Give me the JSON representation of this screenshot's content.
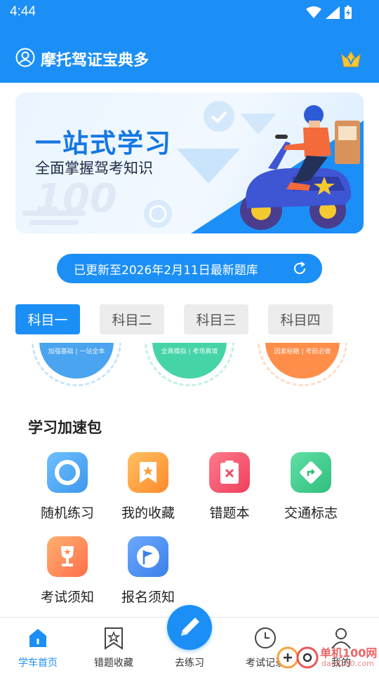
{
  "status": {
    "time": "4:44"
  },
  "header": {
    "title": "摩托驾证宝典多"
  },
  "banner": {
    "title": "一站式学习",
    "subtitle": "全面掌握驾考知识",
    "badge_text": "100"
  },
  "update": {
    "text": "已更新至2026年2月11日最新题库"
  },
  "tabs": [
    {
      "label": "科目一",
      "active": true
    },
    {
      "label": "科目二",
      "active": false
    },
    {
      "label": "科目三",
      "active": false
    },
    {
      "label": "科目四",
      "active": false
    }
  ],
  "circles": [
    {
      "caption": "加强基础 | 一站全本",
      "color": "#4aa4ef"
    },
    {
      "caption": "全真模拟 | 考场真境",
      "color": "#45d3a8"
    },
    {
      "caption": "因素秘籍 | 考前必做",
      "color": "#ff8e4a"
    }
  ],
  "section": {
    "title": "学习加速包"
  },
  "tiles": [
    {
      "label": "随机练习",
      "icon": "target-icon",
      "color": "#49a8f1"
    },
    {
      "label": "我的收藏",
      "icon": "bookmark-star-icon",
      "color": "#ff9f3a"
    },
    {
      "label": "错题本",
      "icon": "clipboard-x-icon",
      "color": "#f6556e"
    },
    {
      "label": "交通标志",
      "icon": "turn-sign-icon",
      "color": "#3cc98a"
    },
    {
      "label": "考试须知",
      "icon": "trophy-icon",
      "color": "#ff8a57"
    },
    {
      "label": "报名须知",
      "icon": "flag-icon",
      "color": "#4a8cf0"
    }
  ],
  "nav": [
    {
      "label": "学车首页",
      "icon": "home-icon",
      "active": true
    },
    {
      "label": "错题收藏",
      "icon": "bookmark-icon",
      "active": false
    },
    {
      "label": "去练习",
      "icon": "pencil-icon",
      "active": false
    },
    {
      "label": "考试记录",
      "icon": "clock-icon",
      "active": false
    },
    {
      "label": "我的",
      "icon": "user-icon",
      "active": false
    }
  ],
  "watermark": {
    "text": "单机100网",
    "url_text": "danji100.com"
  },
  "colors": {
    "primary": "#1b8ff6",
    "tab_inactive": "#ececec"
  }
}
